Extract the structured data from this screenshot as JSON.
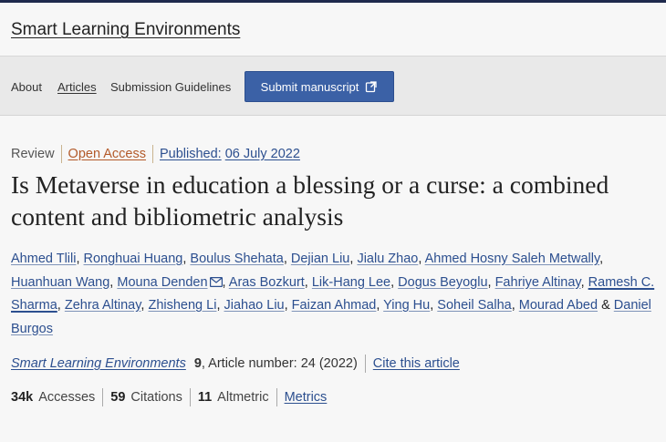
{
  "header": {
    "journal_title": "Smart Learning Environments"
  },
  "nav": {
    "about": "About",
    "articles": "Articles",
    "guidelines": "Submission Guidelines",
    "submit": "Submit manuscript"
  },
  "article": {
    "type": "Review",
    "access": "Open Access",
    "published_label": "Published:",
    "published_date": "06 July 2022",
    "title": "Is Metaverse in education a blessing or a curse: a combined content and bibliometric analysis",
    "authors": [
      "Ahmed Tlili",
      "Ronghuai Huang",
      "Boulus Shehata",
      "Dejian Liu",
      "Jialu Zhao",
      "Ahmed Hosny Saleh Metwally",
      "Huanhuan Wang",
      "Mouna Denden",
      "Aras Bozkurt",
      "Lik-Hang Lee",
      "Dogus Beyoglu",
      "Fahriye Altinay",
      "Ramesh C. Sharma",
      "Zehra Altinay",
      "Zhisheng Li",
      "Jiahao Liu",
      "Faizan Ahmad",
      "Ying Hu",
      "Soheil Salha",
      "Mourad Abed",
      "Daniel Burgos"
    ],
    "authors_and": "&"
  },
  "citation": {
    "journal": "Smart Learning Environments",
    "volume": "9",
    "rest": ", Article number: 24 (2022)",
    "cite_link": "Cite this article"
  },
  "metrics": {
    "accesses_value": "34k",
    "accesses_label": "Accesses",
    "citations_value": "59",
    "citations_label": "Citations",
    "altmetric_value": "11",
    "altmetric_label": "Altmetric",
    "metrics_link": "Metrics"
  },
  "colors": {
    "link": "#2c4f8f",
    "open_access": "#b35a2a",
    "button": "#3b61a6"
  }
}
